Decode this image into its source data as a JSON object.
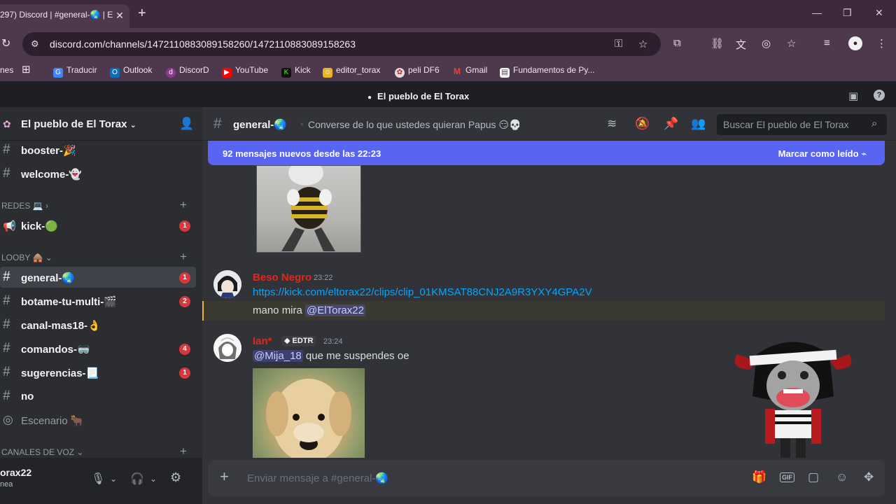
{
  "browser": {
    "tab_title": "297) Discord | #general-🌏 | E",
    "new_tab": "+",
    "url": "discord.com/channels/1472110883089158260/1472110883089158263",
    "bookmarks": [
      {
        "label": "nes",
        "icon": ""
      },
      {
        "label": "Traducir",
        "icon": "translate-icon"
      },
      {
        "label": "Outlook",
        "icon": "outlook-icon"
      },
      {
        "label": "DiscorD",
        "icon": "discord-icon"
      },
      {
        "label": "YouTube",
        "icon": "youtube-icon"
      },
      {
        "label": "Kick",
        "icon": "kick-icon"
      },
      {
        "label": "editor_torax",
        "icon": "editor-icon"
      },
      {
        "label": "peli DF6",
        "icon": "movie-icon"
      },
      {
        "label": "Gmail",
        "icon": "gmail-icon"
      },
      {
        "label": "Fundamentos de Py...",
        "icon": "doc-icon"
      }
    ]
  },
  "app": {
    "title": "El pueblo de El Torax"
  },
  "sidebar": {
    "server_name": "El pueblo de El Torax",
    "channels": [
      {
        "name": "booster-🎉",
        "badge": ""
      },
      {
        "name": "welcome-👻",
        "badge": ""
      }
    ],
    "category_redes": "REDES 💻",
    "redes_channels": [
      {
        "name": "kick-🟢",
        "badge": "1"
      }
    ],
    "category_looby": "LOOBY 🛖",
    "looby_channels": [
      {
        "name": "general-🌏",
        "badge": "1"
      },
      {
        "name": "botame-tu-multi-🎬",
        "badge": "2"
      },
      {
        "name": "canal-mas18-👌",
        "badge": ""
      },
      {
        "name": "comandos-🥽",
        "badge": "4"
      },
      {
        "name": "sugerencias-📃",
        "badge": "1"
      },
      {
        "name": "no",
        "badge": ""
      },
      {
        "name": "Escenario 🐂",
        "badge": ""
      }
    ],
    "category_voz": "CANALES DE VOZ",
    "user": {
      "name": "orax22",
      "status": "nea"
    }
  },
  "main": {
    "channel_name": "general-🌏",
    "topic": "Converse de lo que ustedes quieran Papus 😏💀",
    "search_placeholder": "Buscar El pueblo de El Torax",
    "new_messages": "92 mensajes nuevos desde las 22:23",
    "mark_read": "Marcar como leído",
    "messages": [
      {
        "author": "Beso Negro",
        "author_color": "#e0271a",
        "time": "23:22",
        "link": "https://kick.com/eltorax22/clips/clip_01KMSAT88CNJ2A9R3YXY4GPA2V",
        "text": "mano mira",
        "mention": "@ElTorax22"
      },
      {
        "author": "Ian*",
        "author_color": "#e0271a",
        "tag": "EDTR",
        "time": "23:24",
        "mention": "@Mija_18",
        "text": " que me suspendes oe"
      }
    ],
    "composer_placeholder": "Enviar mensaje a #general-🌏"
  },
  "colors": {
    "blurple": "#5865f2",
    "badge_red": "#da373c",
    "link_blue": "#00a8fc"
  }
}
